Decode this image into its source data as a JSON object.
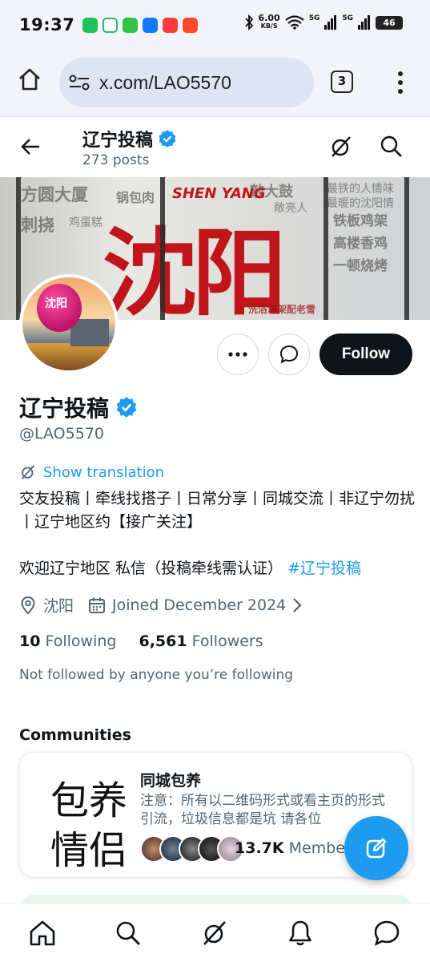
{
  "status_bar": {
    "time": "19:37",
    "net_speed": "6.00",
    "net_unit": "KB/S",
    "signal1": "5G",
    "signal2": "5G",
    "battery": "46"
  },
  "browser": {
    "url": "x.com/LAO5570",
    "tab_count": "3"
  },
  "header": {
    "title": "辽宁投稿",
    "posts": "273 posts"
  },
  "banner": {
    "big_text": "沈阳",
    "latin_text": "SHEN YANG",
    "words": [
      "方圆大厦",
      "锅包肉",
      "刺挠",
      "鸡蛋糕",
      "最铁的人情味",
      "最暖的沈阳情",
      "铁板鸡架",
      "高楼香鸡",
      "一顿烧烤",
      "洗浴鸡架配老雪",
      "敲大鼓",
      "敞亮人"
    ]
  },
  "avatar_text": "沈阳",
  "actions": {
    "follow_label": "Follow"
  },
  "profile": {
    "name": "辽宁投稿",
    "handle": "@LAO5570",
    "show_translation": "Show translation",
    "bio": "交友投稿丨牵线找搭子丨日常分享丨同城交流丨非辽宁勿扰丨辽宁地区约【接广关注】",
    "bio_line2": "欢迎辽宁地区 私信（投稿牵线需认证）",
    "hashtag": "#辽宁投稿",
    "location": "沈阳",
    "joined": "Joined December 2024",
    "following_count": "10",
    "following_label": "Following",
    "followers_count": "6,561",
    "followers_label": "Followers",
    "not_followed": "Not followed by anyone you’re following"
  },
  "communities": {
    "title": "Communities",
    "card": {
      "image_line1": "包养",
      "image_line2": "情侣",
      "name": "同城包养",
      "description": "注意：所有以二维码形式或看主页的形式引流，垃圾信息都是坑 请各位",
      "members_count": "13.7K",
      "members_label": "Members"
    }
  },
  "colors": {
    "accent": "#1d9bf0",
    "text_primary": "#0f1419",
    "text_secondary": "#536471",
    "follow_bg": "#0f1419",
    "banner_red": "#c0151b"
  },
  "icons": {
    "browser": [
      "home-icon",
      "site-settings-icon",
      "tabs-icon",
      "more-vert-icon"
    ],
    "header": [
      "back-arrow-icon",
      "grok-icon",
      "search-icon"
    ],
    "bottom_nav": [
      "home-icon",
      "search-icon",
      "grok-icon",
      "notifications-icon",
      "messages-icon"
    ]
  }
}
